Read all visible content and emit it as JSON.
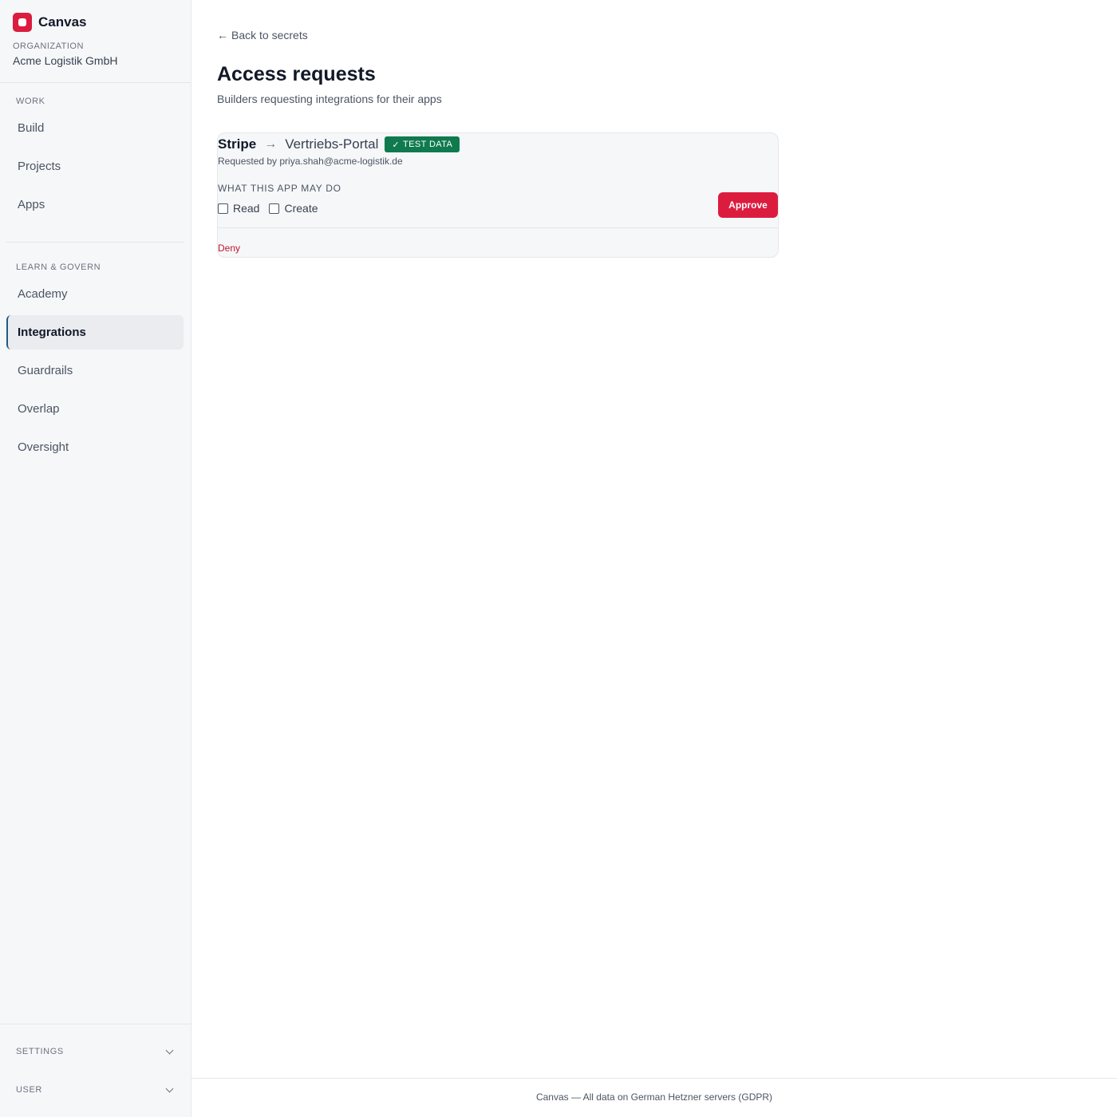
{
  "app": {
    "name": "Canvas",
    "brand_color": "#dc1c3f"
  },
  "organization": {
    "label": "ORGANIZATION",
    "name": "Acme Logistik GmbH"
  },
  "sidebar": {
    "work_label": "WORK",
    "work_items": [
      {
        "label": "Build",
        "active": false
      },
      {
        "label": "Projects",
        "active": false
      },
      {
        "label": "Apps",
        "active": false
      }
    ],
    "govern_label": "LEARN & GOVERN",
    "govern_items": [
      {
        "label": "Academy",
        "active": false
      },
      {
        "label": "Integrations",
        "active": true
      },
      {
        "label": "Guardrails",
        "active": false
      },
      {
        "label": "Overlap",
        "active": false
      },
      {
        "label": "Oversight",
        "active": false
      }
    ],
    "settings_label": "SETTINGS",
    "user_label": "USER"
  },
  "main": {
    "back_label": "Back to secrets",
    "title": "Access requests",
    "subtitle": "Builders requesting integrations for their apps"
  },
  "request": {
    "service": "Stripe",
    "app": "Vertriebs-Portal",
    "badge": "TEST DATA",
    "badge_color": "#0f7a4e",
    "requested_by": "Requested by priya.shah@acme-logistik.de",
    "permissions_label": "WHAT THIS APP MAY DO",
    "permissions": [
      {
        "label": "Read",
        "checked": false
      },
      {
        "label": "Create",
        "checked": false
      }
    ],
    "approve_label": "Approve",
    "deny_label": "Deny"
  },
  "footer": {
    "text": "Canvas — All data on German Hetzner servers (GDPR)"
  }
}
